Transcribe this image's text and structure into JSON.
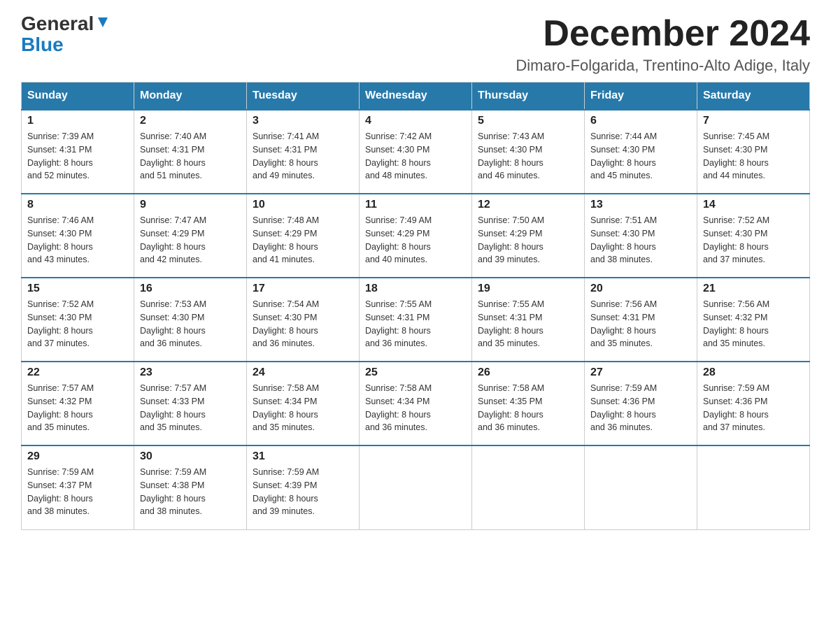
{
  "header": {
    "logo_line1": "General",
    "logo_line2": "Blue",
    "month": "December 2024",
    "location": "Dimaro-Folgarida, Trentino-Alto Adige, Italy"
  },
  "weekdays": [
    "Sunday",
    "Monday",
    "Tuesday",
    "Wednesday",
    "Thursday",
    "Friday",
    "Saturday"
  ],
  "weeks": [
    [
      {
        "day": "1",
        "sunrise": "7:39 AM",
        "sunset": "4:31 PM",
        "daylight": "8 hours and 52 minutes."
      },
      {
        "day": "2",
        "sunrise": "7:40 AM",
        "sunset": "4:31 PM",
        "daylight": "8 hours and 51 minutes."
      },
      {
        "day": "3",
        "sunrise": "7:41 AM",
        "sunset": "4:31 PM",
        "daylight": "8 hours and 49 minutes."
      },
      {
        "day": "4",
        "sunrise": "7:42 AM",
        "sunset": "4:30 PM",
        "daylight": "8 hours and 48 minutes."
      },
      {
        "day": "5",
        "sunrise": "7:43 AM",
        "sunset": "4:30 PM",
        "daylight": "8 hours and 46 minutes."
      },
      {
        "day": "6",
        "sunrise": "7:44 AM",
        "sunset": "4:30 PM",
        "daylight": "8 hours and 45 minutes."
      },
      {
        "day": "7",
        "sunrise": "7:45 AM",
        "sunset": "4:30 PM",
        "daylight": "8 hours and 44 minutes."
      }
    ],
    [
      {
        "day": "8",
        "sunrise": "7:46 AM",
        "sunset": "4:30 PM",
        "daylight": "8 hours and 43 minutes."
      },
      {
        "day": "9",
        "sunrise": "7:47 AM",
        "sunset": "4:29 PM",
        "daylight": "8 hours and 42 minutes."
      },
      {
        "day": "10",
        "sunrise": "7:48 AM",
        "sunset": "4:29 PM",
        "daylight": "8 hours and 41 minutes."
      },
      {
        "day": "11",
        "sunrise": "7:49 AM",
        "sunset": "4:29 PM",
        "daylight": "8 hours and 40 minutes."
      },
      {
        "day": "12",
        "sunrise": "7:50 AM",
        "sunset": "4:29 PM",
        "daylight": "8 hours and 39 minutes."
      },
      {
        "day": "13",
        "sunrise": "7:51 AM",
        "sunset": "4:30 PM",
        "daylight": "8 hours and 38 minutes."
      },
      {
        "day": "14",
        "sunrise": "7:52 AM",
        "sunset": "4:30 PM",
        "daylight": "8 hours and 37 minutes."
      }
    ],
    [
      {
        "day": "15",
        "sunrise": "7:52 AM",
        "sunset": "4:30 PM",
        "daylight": "8 hours and 37 minutes."
      },
      {
        "day": "16",
        "sunrise": "7:53 AM",
        "sunset": "4:30 PM",
        "daylight": "8 hours and 36 minutes."
      },
      {
        "day": "17",
        "sunrise": "7:54 AM",
        "sunset": "4:30 PM",
        "daylight": "8 hours and 36 minutes."
      },
      {
        "day": "18",
        "sunrise": "7:55 AM",
        "sunset": "4:31 PM",
        "daylight": "8 hours and 36 minutes."
      },
      {
        "day": "19",
        "sunrise": "7:55 AM",
        "sunset": "4:31 PM",
        "daylight": "8 hours and 35 minutes."
      },
      {
        "day": "20",
        "sunrise": "7:56 AM",
        "sunset": "4:31 PM",
        "daylight": "8 hours and 35 minutes."
      },
      {
        "day": "21",
        "sunrise": "7:56 AM",
        "sunset": "4:32 PM",
        "daylight": "8 hours and 35 minutes."
      }
    ],
    [
      {
        "day": "22",
        "sunrise": "7:57 AM",
        "sunset": "4:32 PM",
        "daylight": "8 hours and 35 minutes."
      },
      {
        "day": "23",
        "sunrise": "7:57 AM",
        "sunset": "4:33 PM",
        "daylight": "8 hours and 35 minutes."
      },
      {
        "day": "24",
        "sunrise": "7:58 AM",
        "sunset": "4:34 PM",
        "daylight": "8 hours and 35 minutes."
      },
      {
        "day": "25",
        "sunrise": "7:58 AM",
        "sunset": "4:34 PM",
        "daylight": "8 hours and 36 minutes."
      },
      {
        "day": "26",
        "sunrise": "7:58 AM",
        "sunset": "4:35 PM",
        "daylight": "8 hours and 36 minutes."
      },
      {
        "day": "27",
        "sunrise": "7:59 AM",
        "sunset": "4:36 PM",
        "daylight": "8 hours and 36 minutes."
      },
      {
        "day": "28",
        "sunrise": "7:59 AM",
        "sunset": "4:36 PM",
        "daylight": "8 hours and 37 minutes."
      }
    ],
    [
      {
        "day": "29",
        "sunrise": "7:59 AM",
        "sunset": "4:37 PM",
        "daylight": "8 hours and 38 minutes."
      },
      {
        "day": "30",
        "sunrise": "7:59 AM",
        "sunset": "4:38 PM",
        "daylight": "8 hours and 38 minutes."
      },
      {
        "day": "31",
        "sunrise": "7:59 AM",
        "sunset": "4:39 PM",
        "daylight": "8 hours and 39 minutes."
      },
      null,
      null,
      null,
      null
    ]
  ],
  "labels": {
    "sunrise": "Sunrise:",
    "sunset": "Sunset:",
    "daylight": "Daylight:"
  }
}
